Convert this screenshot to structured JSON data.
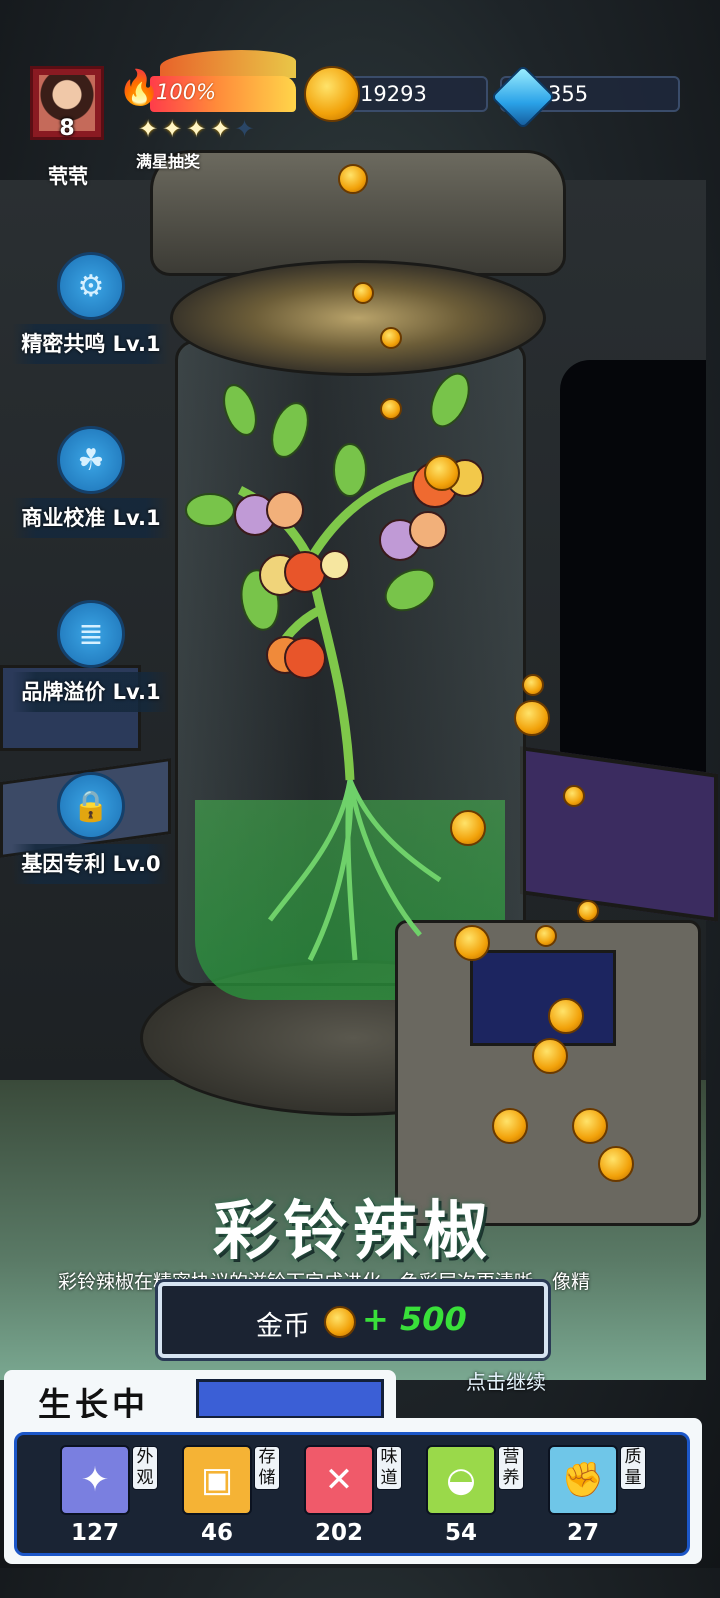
{
  "player": {
    "name": "茕茕",
    "level": "8"
  },
  "energy": {
    "percent_text": "100%",
    "stars_filled": 4,
    "stars_total": 5,
    "stars_label": "满星抽奖"
  },
  "currency": {
    "gold": "19293",
    "gems": "355"
  },
  "skills": [
    {
      "label": "精密共鸣 Lv.1",
      "icon": "gear-plant-icon"
    },
    {
      "label": "商业校准 Lv.1",
      "icon": "leaf-frame-icon"
    },
    {
      "label": "品牌溢价 Lv.1",
      "icon": "fence-icon"
    },
    {
      "label": "基因专利 Lv.0",
      "icon": "lock-icon"
    }
  ],
  "result": {
    "title": "彩铃辣椒",
    "description": "彩铃辣椒在精密协议的滋铃下完成进化，色彩层次更清晰，像精",
    "reward_label": "金币",
    "reward_amount": "+ 500",
    "continue_text": "点击继续"
  },
  "growth": {
    "label": "生长中"
  },
  "stats": [
    {
      "tag": "外观",
      "value": "127",
      "icon": "sparkle-icon",
      "color": "#7a7fe0"
    },
    {
      "tag": "存储",
      "value": "46",
      "icon": "box-icon",
      "color": "#f5b335"
    },
    {
      "tag": "味道",
      "value": "202",
      "icon": "fork-knife-icon",
      "color": "#f05a6a"
    },
    {
      "tag": "营养",
      "value": "54",
      "icon": "lemon-icon",
      "color": "#9ad94a"
    },
    {
      "tag": "质量",
      "value": "27",
      "icon": "muscle-icon",
      "color": "#6fc6e8"
    }
  ]
}
